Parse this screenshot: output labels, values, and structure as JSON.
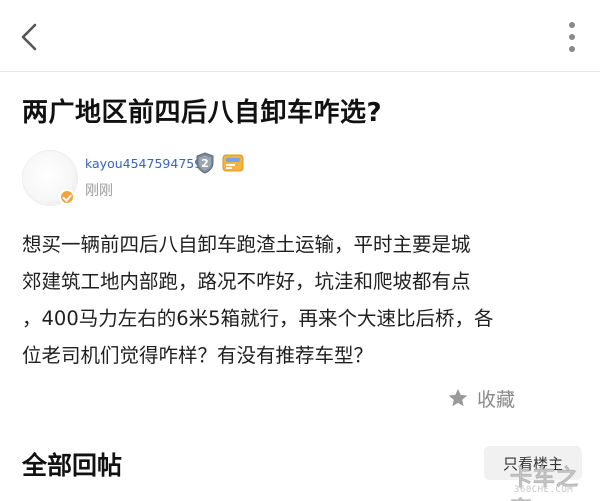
{
  "topbar": {
    "back_icon": "chevron-left-icon",
    "more_icon": "more-vertical-icon"
  },
  "post": {
    "title": "两广地区前四后八自卸车咋选?",
    "author": {
      "username": "kayou4547594759",
      "level": "2",
      "time": "刚刚"
    },
    "body_lines": [
      "想买一辆前四后八自卸车跑渣土运输，平时主要是城",
      "郊建筑工地内部跑，路况不咋好，坑洼和爬坡都有点",
      "，400马力左右的6米5箱就行，再来个大速比后桥，各",
      "位老司机们觉得咋样？有没有推荐车型？"
    ],
    "favorite_label": "收藏"
  },
  "replies": {
    "section_title": "全部回帖",
    "only_op_label": "只看楼主"
  },
  "watermark": {
    "logo": "卡车之家",
    "url": "360CHE.COM"
  },
  "colors": {
    "username": "#3a64b8",
    "muted": "#9a9a9a",
    "badge_orange": "#f1a43c"
  }
}
